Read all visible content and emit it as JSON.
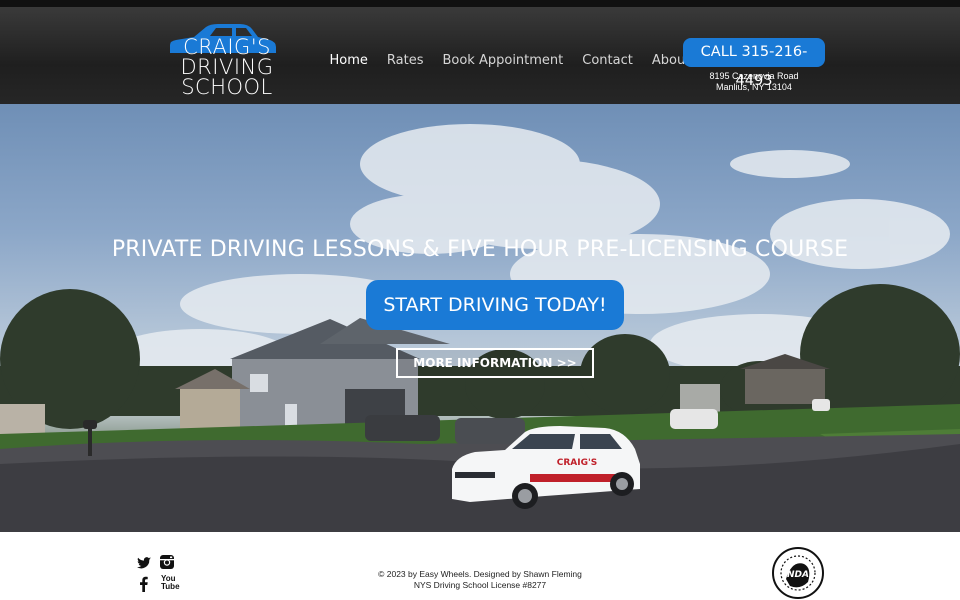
{
  "header": {
    "logo": {
      "line1": "CRAIG'S",
      "line2": "DRIVING",
      "line3": "SCHOOL"
    },
    "nav": [
      {
        "label": "Home",
        "active": true
      },
      {
        "label": "Rates",
        "active": false
      },
      {
        "label": "Book Appointment",
        "active": false
      },
      {
        "label": "Contact",
        "active": false
      },
      {
        "label": "About",
        "active": false
      }
    ],
    "call_label": "CALL 315-216-4493",
    "address_line1": "8195 Cazenovia Road",
    "address_line2": "Manlius, NY 13104"
  },
  "hero": {
    "headline": "PRIVATE DRIVING LESSONS & FIVE HOUR PRE-LICENSING COURSE",
    "start_label": "START  DRIVING TODAY!",
    "more_label": "MORE INFORMATION >>",
    "car_decal": "CRAIG'S"
  },
  "footer": {
    "social_icons": [
      "twitter-icon",
      "instagram-icon",
      "facebook-icon",
      "youtube-icon"
    ],
    "youtube_text": "You Tube",
    "copyright_line1": "© 2023 by Easy Wheels. Designed by Shawn Fleming",
    "copyright_line2": "NYS Driving School License #8277",
    "nda_badge_text": "NDA"
  },
  "colors": {
    "accent_blue": "#1a7ad6",
    "header_dark": "#262626"
  }
}
